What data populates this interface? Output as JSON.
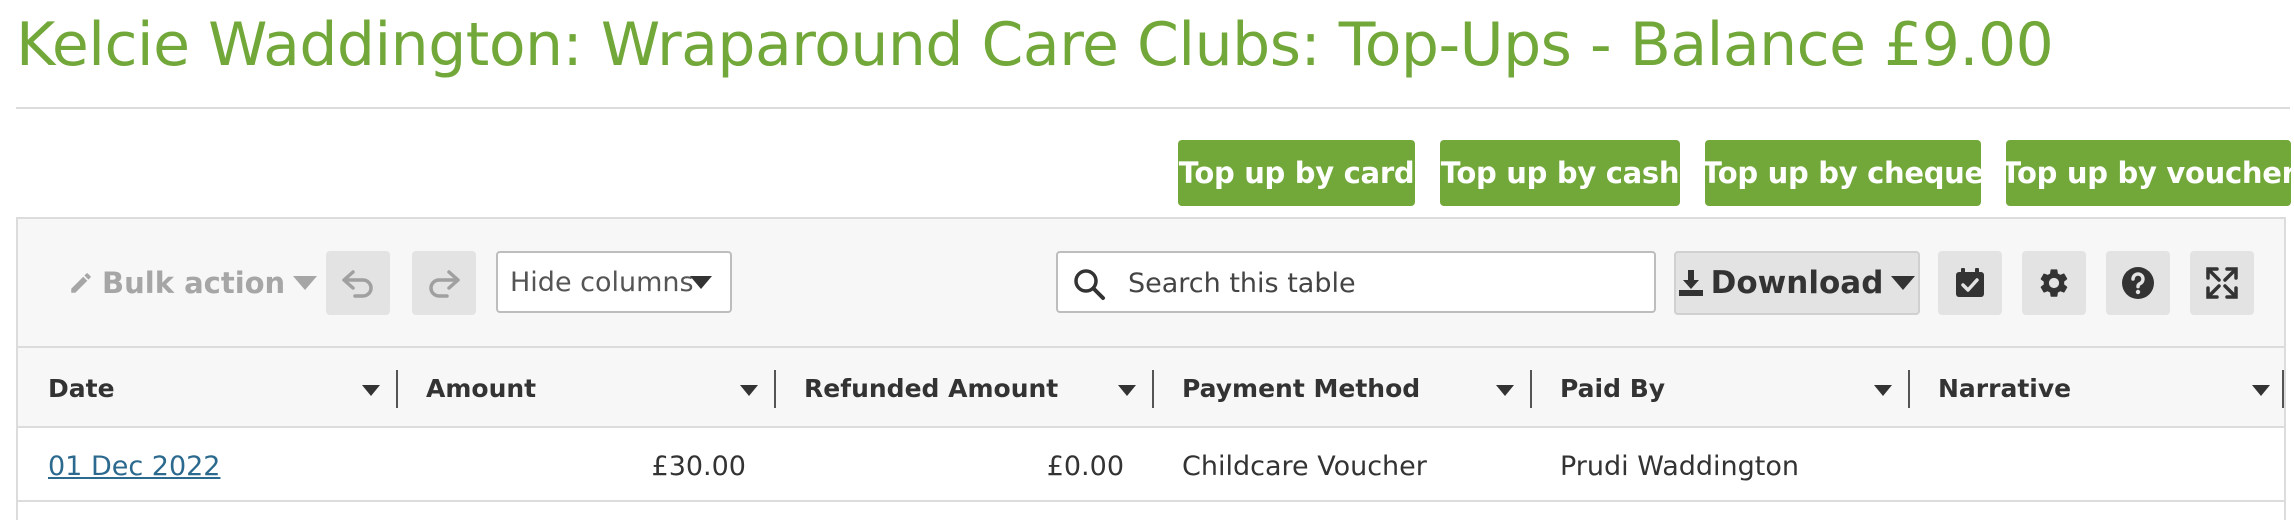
{
  "page": {
    "title": "Kelcie Waddington: Wraparound Care Clubs: Top-Ups - Balance £9.00",
    "accent_color": "#72a83a"
  },
  "topup_buttons": [
    {
      "label": "Top up by card"
    },
    {
      "label": "Top up by cash"
    },
    {
      "label": "Top up by cheque"
    },
    {
      "label": "Top up by voucher"
    }
  ],
  "toolbar": {
    "bulk_action_label": "Bulk action",
    "hide_columns_label": "Hide columns",
    "search_placeholder": "Search this table",
    "download_label": "Download",
    "icons": [
      "undo-icon",
      "redo-icon",
      "calendar-check-icon",
      "gear-icon",
      "help-icon",
      "expand-icon"
    ]
  },
  "table": {
    "columns": [
      "Date",
      "Amount",
      "Refunded Amount",
      "Payment Method",
      "Paid By",
      "Narrative"
    ],
    "rows": [
      {
        "date": "01 Dec 2022",
        "amount": "£30.00",
        "refunded": "£0.00",
        "method": "Childcare Voucher",
        "paid_by": "Prudi Waddington",
        "narrative": ""
      }
    ]
  }
}
